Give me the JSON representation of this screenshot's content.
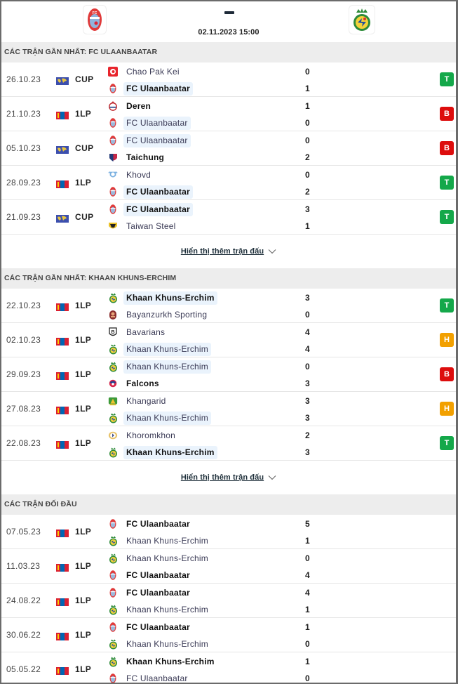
{
  "header": {
    "home_team": "FC Ulaanbaatar",
    "away_team": "Khaan Khuns-Erchim",
    "score_separator": "-",
    "datetime": "02.11.2023 15:00"
  },
  "colors": {
    "win": "#14a84a",
    "loss": "#dd0d0d",
    "draw": "#f2a000",
    "highlight": "#eaf3fc",
    "section_bg": "#ededed"
  },
  "sections": [
    {
      "title": "CÁC TRẬN GẦN NHẤT: FC ULAANBAATAR",
      "more_label": "Hiển thị thêm trận đấu",
      "matches": [
        {
          "date": "26.10.23",
          "comp": "CUP",
          "flag": "world-flag",
          "home": {
            "name": "Chao Pak Kei",
            "crest": "chao-pak-kei",
            "bold": false,
            "highlight": false
          },
          "home_score": "0",
          "away": {
            "name": "FC Ulaanbaatar",
            "crest": "fc-ulaanbaatar",
            "bold": true,
            "highlight": true
          },
          "away_score": "1",
          "result": "T",
          "result_type": "win"
        },
        {
          "date": "21.10.23",
          "comp": "1LP",
          "flag": "mongolia-flag",
          "home": {
            "name": "Deren",
            "crest": "deren",
            "bold": true,
            "highlight": false
          },
          "home_score": "1",
          "away": {
            "name": "FC Ulaanbaatar",
            "crest": "fc-ulaanbaatar",
            "bold": false,
            "highlight": true
          },
          "away_score": "0",
          "result": "B",
          "result_type": "loss"
        },
        {
          "date": "05.10.23",
          "comp": "CUP",
          "flag": "world-flag",
          "home": {
            "name": "FC Ulaanbaatar",
            "crest": "fc-ulaanbaatar",
            "bold": false,
            "highlight": true
          },
          "home_score": "0",
          "away": {
            "name": "Taichung",
            "crest": "taichung",
            "bold": true,
            "highlight": false
          },
          "away_score": "2",
          "result": "B",
          "result_type": "loss"
        },
        {
          "date": "28.09.23",
          "comp": "1LP",
          "flag": "mongolia-flag",
          "home": {
            "name": "Khovd",
            "crest": "khovd",
            "bold": false,
            "highlight": false
          },
          "home_score": "0",
          "away": {
            "name": "FC Ulaanbaatar",
            "crest": "fc-ulaanbaatar",
            "bold": true,
            "highlight": true
          },
          "away_score": "2",
          "result": "T",
          "result_type": "win"
        },
        {
          "date": "21.09.23",
          "comp": "CUP",
          "flag": "world-flag",
          "home": {
            "name": "FC Ulaanbaatar",
            "crest": "fc-ulaanbaatar",
            "bold": true,
            "highlight": true
          },
          "home_score": "3",
          "away": {
            "name": "Taiwan Steel",
            "crest": "taiwan-steel",
            "bold": false,
            "highlight": false
          },
          "away_score": "1",
          "result": "T",
          "result_type": "win"
        }
      ]
    },
    {
      "title": "CÁC TRẬN GẦN NHẤT: KHAAN KHUNS-ERCHIM",
      "more_label": "Hiển thị thêm trận đấu",
      "matches": [
        {
          "date": "22.10.23",
          "comp": "1LP",
          "flag": "mongolia-flag",
          "home": {
            "name": "Khaan Khuns-Erchim",
            "crest": "khaan-khuns-erchim",
            "bold": true,
            "highlight": true
          },
          "home_score": "3",
          "away": {
            "name": "Bayanzurkh Sporting",
            "crest": "bayanzurkh",
            "bold": false,
            "highlight": false
          },
          "away_score": "0",
          "result": "T",
          "result_type": "win"
        },
        {
          "date": "02.10.23",
          "comp": "1LP",
          "flag": "mongolia-flag",
          "home": {
            "name": "Bavarians",
            "crest": "bavarians",
            "bold": false,
            "highlight": false
          },
          "home_score": "4",
          "away": {
            "name": "Khaan Khuns-Erchim",
            "crest": "khaan-khuns-erchim",
            "bold": false,
            "highlight": true
          },
          "away_score": "4",
          "result": "H",
          "result_type": "draw"
        },
        {
          "date": "29.09.23",
          "comp": "1LP",
          "flag": "mongolia-flag",
          "home": {
            "name": "Khaan Khuns-Erchim",
            "crest": "khaan-khuns-erchim",
            "bold": false,
            "highlight": true
          },
          "home_score": "0",
          "away": {
            "name": "Falcons",
            "crest": "falcons",
            "bold": true,
            "highlight": false
          },
          "away_score": "3",
          "result": "B",
          "result_type": "loss"
        },
        {
          "date": "27.08.23",
          "comp": "1LP",
          "flag": "mongolia-flag",
          "home": {
            "name": "Khangarid",
            "crest": "khangarid",
            "bold": false,
            "highlight": false
          },
          "home_score": "3",
          "away": {
            "name": "Khaan Khuns-Erchim",
            "crest": "khaan-khuns-erchim",
            "bold": false,
            "highlight": true
          },
          "away_score": "3",
          "result": "H",
          "result_type": "draw"
        },
        {
          "date": "22.08.23",
          "comp": "1LP",
          "flag": "mongolia-flag",
          "home": {
            "name": "Khoromkhon",
            "crest": "khoromkhon",
            "bold": false,
            "highlight": false
          },
          "home_score": "2",
          "away": {
            "name": "Khaan Khuns-Erchim",
            "crest": "khaan-khuns-erchim",
            "bold": true,
            "highlight": true
          },
          "away_score": "3",
          "result": "T",
          "result_type": "win"
        }
      ]
    },
    {
      "title": "CÁC TRẬN ĐỐI ĐẦU",
      "more_label": "",
      "matches": [
        {
          "date": "07.05.23",
          "comp": "1LP",
          "flag": "mongolia-flag",
          "home": {
            "name": "FC Ulaanbaatar",
            "crest": "fc-ulaanbaatar",
            "bold": true,
            "highlight": false
          },
          "home_score": "5",
          "away": {
            "name": "Khaan Khuns-Erchim",
            "crest": "khaan-khuns-erchim",
            "bold": false,
            "highlight": false
          },
          "away_score": "1",
          "result": "",
          "result_type": ""
        },
        {
          "date": "11.03.23",
          "comp": "1LP",
          "flag": "mongolia-flag",
          "home": {
            "name": "Khaan Khuns-Erchim",
            "crest": "khaan-khuns-erchim",
            "bold": false,
            "highlight": false
          },
          "home_score": "0",
          "away": {
            "name": "FC Ulaanbaatar",
            "crest": "fc-ulaanbaatar",
            "bold": true,
            "highlight": false
          },
          "away_score": "4",
          "result": "",
          "result_type": ""
        },
        {
          "date": "24.08.22",
          "comp": "1LP",
          "flag": "mongolia-flag",
          "home": {
            "name": "FC Ulaanbaatar",
            "crest": "fc-ulaanbaatar",
            "bold": true,
            "highlight": false
          },
          "home_score": "4",
          "away": {
            "name": "Khaan Khuns-Erchim",
            "crest": "khaan-khuns-erchim",
            "bold": false,
            "highlight": false
          },
          "away_score": "1",
          "result": "",
          "result_type": ""
        },
        {
          "date": "30.06.22",
          "comp": "1LP",
          "flag": "mongolia-flag",
          "home": {
            "name": "FC Ulaanbaatar",
            "crest": "fc-ulaanbaatar",
            "bold": true,
            "highlight": false
          },
          "home_score": "1",
          "away": {
            "name": "Khaan Khuns-Erchim",
            "crest": "khaan-khuns-erchim",
            "bold": false,
            "highlight": false
          },
          "away_score": "0",
          "result": "",
          "result_type": ""
        },
        {
          "date": "05.05.22",
          "comp": "1LP",
          "flag": "mongolia-flag",
          "home": {
            "name": "Khaan Khuns-Erchim",
            "crest": "khaan-khuns-erchim",
            "bold": true,
            "highlight": false
          },
          "home_score": "1",
          "away": {
            "name": "FC Ulaanbaatar",
            "crest": "fc-ulaanbaatar",
            "bold": false,
            "highlight": false
          },
          "away_score": "0",
          "result": "",
          "result_type": ""
        }
      ]
    }
  ]
}
